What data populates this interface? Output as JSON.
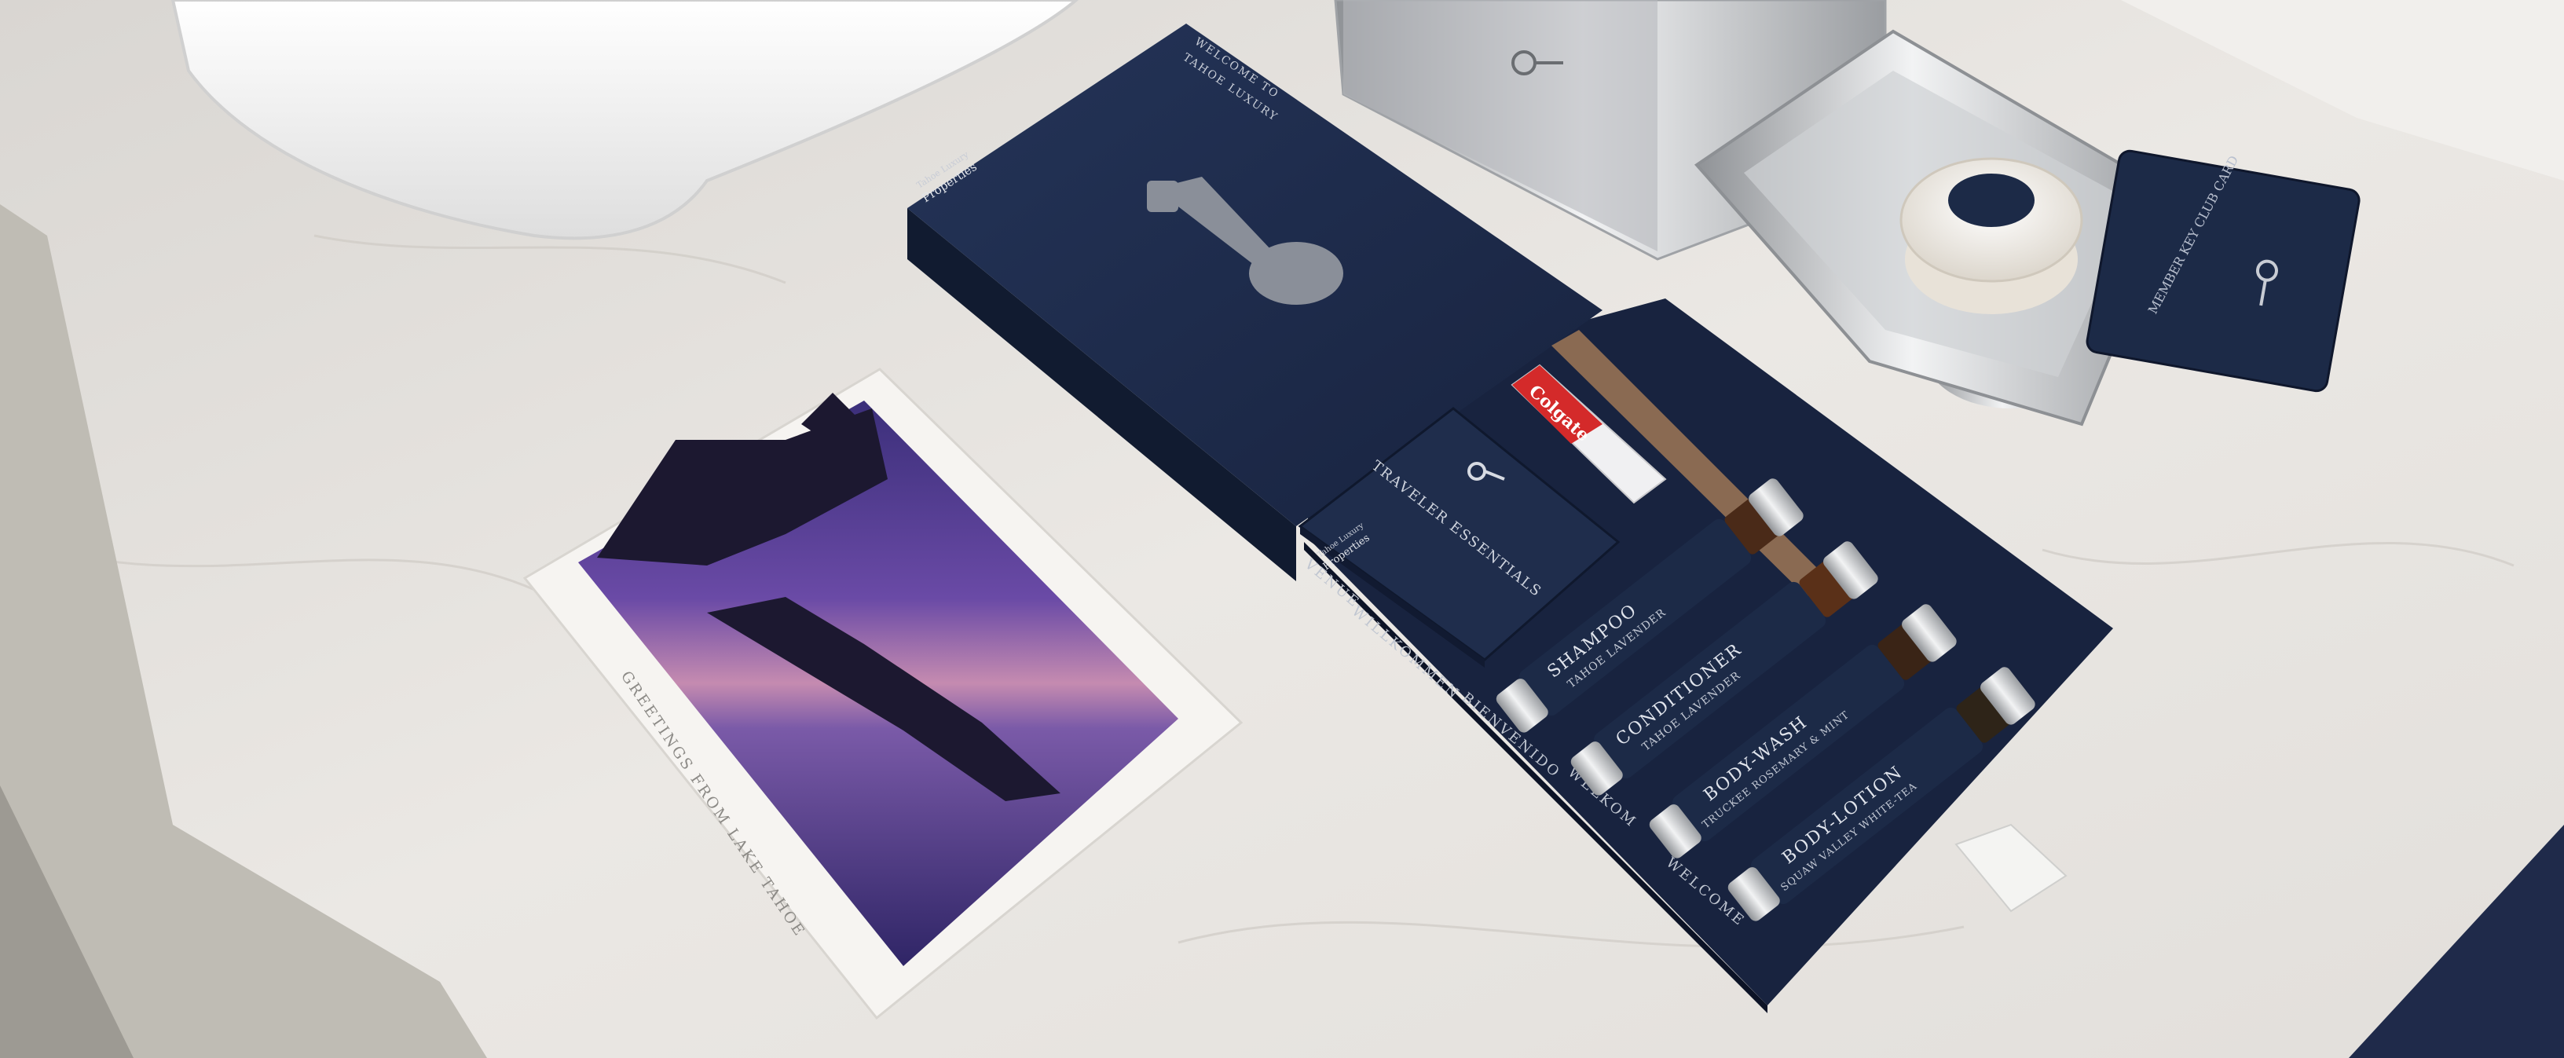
{
  "welcome_box": {
    "lid_text_line1": "WELCOME TO",
    "lid_text_line2": "TAHOE LUXURY",
    "brand_line1": "Tahoe Luxury",
    "brand_line2": "Properties",
    "side_words": [
      "VENUE",
      "WILLKOMMEN",
      "BIENVENIDO",
      "WELKOM",
      "WELCOME"
    ]
  },
  "essentials_pouch": {
    "title": "TRAVELER ESSENTIALS",
    "brand_line1": "Tahoe Luxury",
    "brand_line2": "Properties"
  },
  "toothpaste": {
    "brand": "Colgate"
  },
  "bottles": [
    {
      "product": "SHAMPOO",
      "scent": "TAHOE LAVENDER"
    },
    {
      "product": "CONDITIONER",
      "scent": "TAHOE LAVENDER"
    },
    {
      "product": "BODY-WASH",
      "scent": "TRUCKEE ROSEMARY & MINT"
    },
    {
      "product": "BODY-LOTION",
      "scent": "SQUAW VALLEY WHITE-TEA"
    }
  ],
  "key_card": {
    "title": "MEMBER KEY CLUB CARD"
  },
  "postcard": {
    "caption": "GREETINGS FROM LAKE TAHOE"
  },
  "colors": {
    "navy": "#1c2a47",
    "navy_dark": "#111b30",
    "marble": "#e6e3df",
    "silver": "#c9cbce",
    "purple_sky": "#5a3f8f"
  }
}
